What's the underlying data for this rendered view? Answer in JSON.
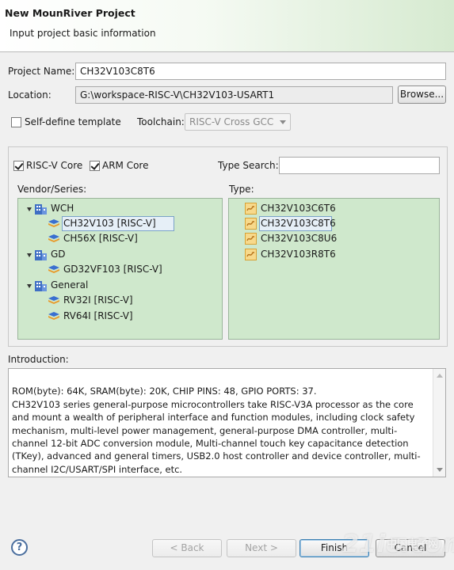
{
  "window": {
    "title": "New MounRiver Project",
    "subtitle": "Input project basic information"
  },
  "project": {
    "name_label": "Project Name:",
    "name_value": "CH32V103C8T6",
    "location_label": "Location:",
    "location_value": "G:\\workspace-RISC-V\\CH32V103-USART1",
    "browse_label": "Browse...",
    "self_define_label": "Self-define template",
    "self_define_checked": false,
    "toolchain_label": "Toolchain:",
    "toolchain_value": "RISC-V Cross GCC"
  },
  "filters": {
    "riscv_label": "RISC-V Core",
    "riscv_checked": true,
    "arm_label": "ARM Core",
    "arm_checked": true,
    "type_search_label": "Type Search:",
    "type_search_value": ""
  },
  "vendor": {
    "label": "Vendor/Series:",
    "tree": [
      {
        "name": "WCH",
        "children": [
          "CH32V103 [RISC-V]",
          "CH56X [RISC-V]"
        ]
      },
      {
        "name": "GD",
        "children": [
          "GD32VF103 [RISC-V]"
        ]
      },
      {
        "name": "General",
        "children": [
          "RV32I [RISC-V]",
          "RV64I [RISC-V]"
        ]
      }
    ],
    "selected": "CH32V103 [RISC-V]"
  },
  "type": {
    "label": "Type:",
    "items": [
      "CH32V103C6T6",
      "CH32V103C8T6",
      "CH32V103C8U6",
      "CH32V103R8T6"
    ],
    "selected": "CH32V103C8T6"
  },
  "introduction": {
    "label": "Introduction:",
    "text": "ROM(byte): 64K, SRAM(byte): 20K, CHIP PINS: 48, GPIO PORTS: 37.\nCH32V103 series general-purpose microcontrollers take RISC-V3A processor as the core and mount a wealth of peripheral interface and function modules, including clock safety mechanism, multi-level power management, general-purpose DMA controller, multi-channel 12-bit ADC conversion module, Multi-channel touch key capacitance detection (TKey), advanced and general timers, USB2.0 host controller and device controller, multi-channel I2C/USART/SPI interface, etc."
  },
  "footer": {
    "help_label": "?",
    "back_label": "< Back",
    "next_label": "Next >",
    "finish_label": "Finish",
    "cancel_label": "Cancel"
  },
  "watermark": {
    "main": "21ic.com",
    "cn": "中国电子网"
  },
  "colors": {
    "panel_bg": "#cfe8cc",
    "header_accent": "#d6ead0",
    "selection": "#e6eff7"
  }
}
